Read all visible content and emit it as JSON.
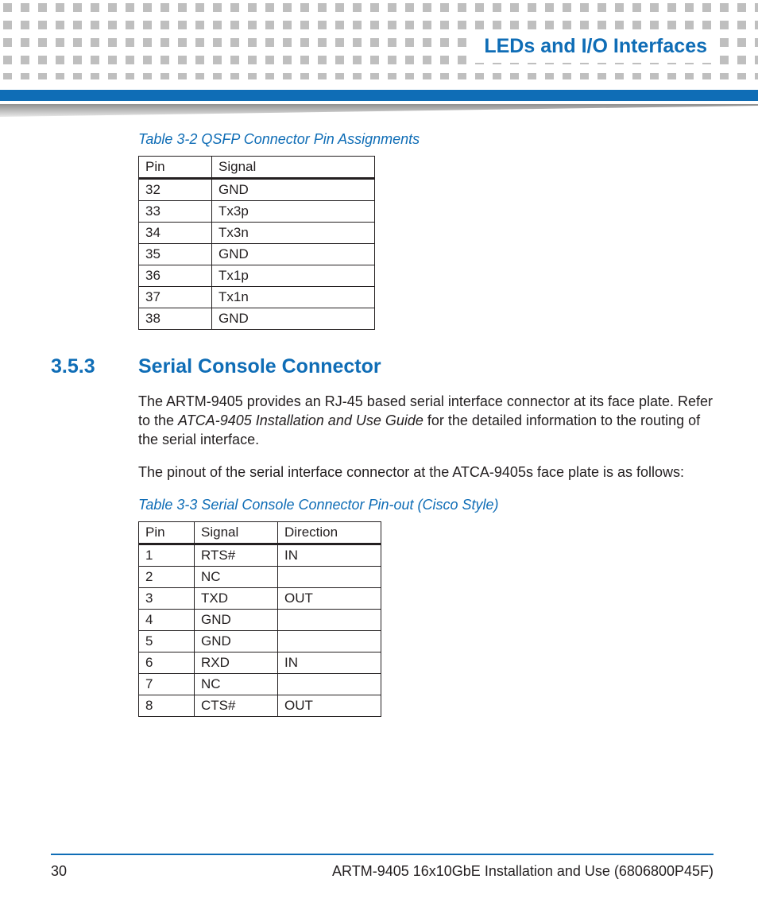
{
  "header": {
    "chapter_title": "LEDs and I/O Interfaces"
  },
  "table1": {
    "caption": "Table 3-2 QSFP Connector Pin Assignments",
    "head": {
      "pin": "Pin",
      "signal": "Signal"
    },
    "rows": [
      {
        "pin": "32",
        "signal": "GND"
      },
      {
        "pin": "33",
        "signal": "Tx3p"
      },
      {
        "pin": "34",
        "signal": "Tx3n"
      },
      {
        "pin": "35",
        "signal": "GND"
      },
      {
        "pin": "36",
        "signal": "Tx1p"
      },
      {
        "pin": "37",
        "signal": "Tx1n"
      },
      {
        "pin": "38",
        "signal": "GND"
      }
    ]
  },
  "section": {
    "number": "3.5.3",
    "title": "Serial Console Connector",
    "para1_a": "The ARTM-9405 provides an RJ-45 based serial interface connector at its face plate. Refer to the ",
    "para1_i": "ATCA-9405 Installation and Use Guide",
    "para1_b": " for the detailed information to the routing of the serial interface.",
    "para2": "The pinout of the serial interface connector at the ATCA-9405s face plate is as follows:"
  },
  "table2": {
    "caption": "Table 3-3 Serial Console Connector Pin-out (Cisco Style)",
    "head": {
      "pin": "Pin",
      "signal": "Signal",
      "direction": "Direction"
    },
    "rows": [
      {
        "pin": "1",
        "signal": "RTS#",
        "direction": "IN"
      },
      {
        "pin": "2",
        "signal": "NC",
        "direction": ""
      },
      {
        "pin": "3",
        "signal": "TXD",
        "direction": "OUT"
      },
      {
        "pin": "4",
        "signal": "GND",
        "direction": ""
      },
      {
        "pin": "5",
        "signal": "GND",
        "direction": ""
      },
      {
        "pin": "6",
        "signal": "RXD",
        "direction": "IN"
      },
      {
        "pin": "7",
        "signal": "NC",
        "direction": ""
      },
      {
        "pin": "8",
        "signal": "CTS#",
        "direction": "OUT"
      }
    ]
  },
  "footer": {
    "page": "30",
    "doc": "ARTM-9405 16x10GbE Installation and Use (6806800P45F)"
  }
}
